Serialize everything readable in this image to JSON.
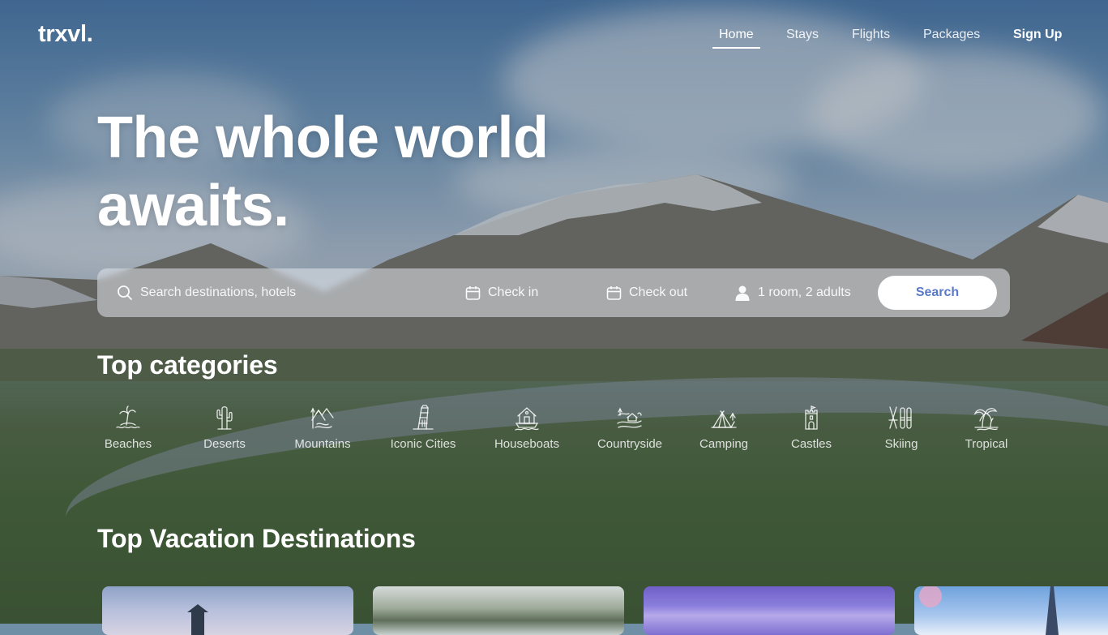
{
  "brand": {
    "logo_text": "trxvl."
  },
  "nav": {
    "items": [
      {
        "label": "Home",
        "active": true
      },
      {
        "label": "Stays"
      },
      {
        "label": "Flights"
      },
      {
        "label": "Packages"
      }
    ],
    "signup_label": "Sign Up"
  },
  "hero": {
    "title_line1": "The whole world",
    "title_line2": "awaits."
  },
  "search": {
    "placeholder": "Search destinations, hotels",
    "value": "",
    "check_in_label": "Check in",
    "check_out_label": "Check out",
    "guests_label": "1 room, 2 adults",
    "button_label": "Search",
    "button_color": "#5a79c8"
  },
  "categories": {
    "title": "Top categories",
    "items": [
      {
        "label": "Beaches",
        "icon": "beach-island-icon"
      },
      {
        "label": "Deserts",
        "icon": "cactus-icon"
      },
      {
        "label": "Mountains",
        "icon": "mountains-icon"
      },
      {
        "label": "Iconic Cities",
        "icon": "leaning-tower-icon"
      },
      {
        "label": "Houseboats",
        "icon": "houseboat-icon"
      },
      {
        "label": "Countryside",
        "icon": "countryside-icon"
      },
      {
        "label": "Camping",
        "icon": "tent-icon"
      },
      {
        "label": "Castles",
        "icon": "castle-icon"
      },
      {
        "label": "Skiing",
        "icon": "skis-icon"
      },
      {
        "label": "Tropical",
        "icon": "palm-trees-icon"
      }
    ]
  },
  "destinations": {
    "title": "Top Vacation Destinations"
  }
}
